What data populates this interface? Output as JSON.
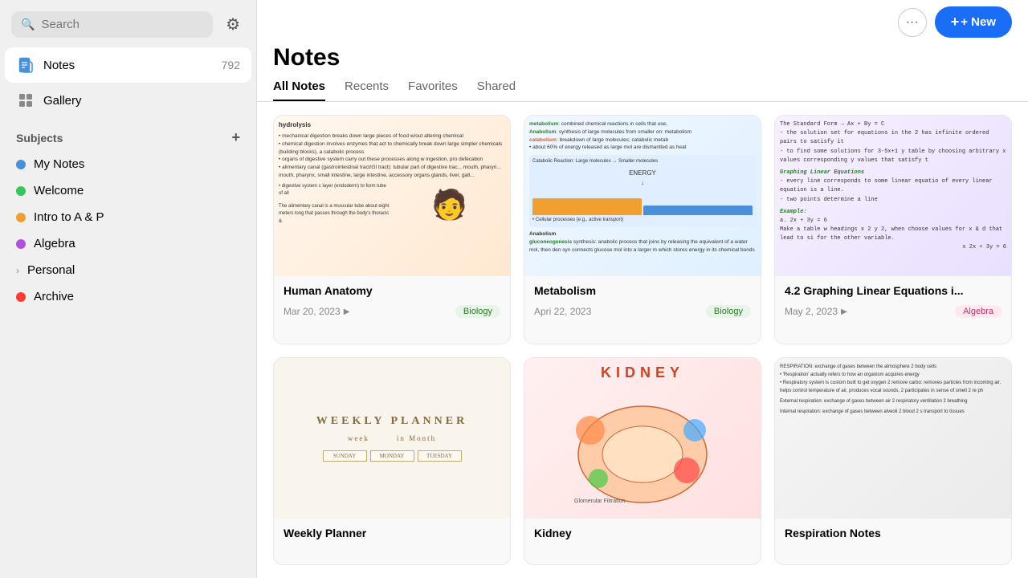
{
  "sidebar": {
    "settings_icon": "⚙",
    "search_placeholder": "Search",
    "nav": [
      {
        "id": "notes",
        "label": "Notes",
        "count": "792",
        "active": true
      },
      {
        "id": "gallery",
        "label": "Gallery",
        "count": ""
      }
    ],
    "subjects_heading": "Subjects",
    "subjects_add_icon": "+",
    "subjects": [
      {
        "id": "my-notes",
        "label": "My Notes",
        "color": "#4a90d9",
        "type": "dot"
      },
      {
        "id": "welcome",
        "label": "Welcome",
        "color": "#34c759",
        "type": "dot"
      },
      {
        "id": "intro",
        "label": "Intro to A & P",
        "color": "#f0a030",
        "type": "dot"
      },
      {
        "id": "algebra",
        "label": "Algebra",
        "color": "#af52de",
        "type": "dot"
      },
      {
        "id": "personal",
        "label": "Personal",
        "color": "#888",
        "type": "chevron"
      },
      {
        "id": "archive",
        "label": "Archive",
        "color": "#ff3b30",
        "type": "dot"
      }
    ]
  },
  "header": {
    "more_icon": "···",
    "new_label": "+ New",
    "page_title": "Notes"
  },
  "tabs": [
    {
      "id": "all-notes",
      "label": "All Notes",
      "active": true
    },
    {
      "id": "recents",
      "label": "Recents",
      "active": false
    },
    {
      "id": "favorites",
      "label": "Favorites",
      "active": false
    },
    {
      "id": "shared",
      "label": "Shared",
      "active": false
    }
  ],
  "notes": [
    {
      "id": "human-anatomy",
      "title": "Human Anatomy",
      "date": "Mar 20, 2023",
      "tag": "Biology",
      "tag_class": "tag-biology",
      "preview_type": "anatomy"
    },
    {
      "id": "metabolism",
      "title": "Metabolism",
      "date": "Apri 22, 2023",
      "tag": "Biology",
      "tag_class": "tag-biology",
      "preview_type": "metabolism"
    },
    {
      "id": "algebra-graphing",
      "title": "4.2 Graphing Linear Equations i...",
      "date": "May 2, 2023",
      "tag": "Algebra",
      "tag_class": "tag-algebra",
      "preview_type": "algebra"
    },
    {
      "id": "weekly-planner",
      "title": "Weekly Planner",
      "date": "",
      "tag": "",
      "tag_class": "",
      "preview_type": "planner"
    },
    {
      "id": "kidney",
      "title": "Kidney",
      "date": "",
      "tag": "",
      "tag_class": "",
      "preview_type": "kidney"
    },
    {
      "id": "respiration",
      "title": "Respiration Notes",
      "date": "",
      "tag": "",
      "tag_class": "",
      "preview_type": "respiration"
    }
  ]
}
